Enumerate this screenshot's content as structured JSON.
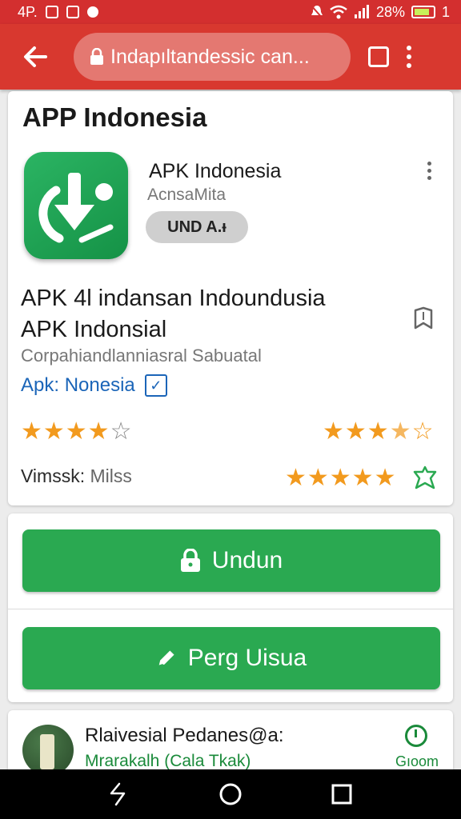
{
  "status_bar": {
    "time": "4P.",
    "battery_percent": "28%",
    "sim": "1",
    "battery_level": 0.7
  },
  "toolbar": {
    "url": "Indapıltandessic can..."
  },
  "page": {
    "title": "APP Indonesia"
  },
  "app": {
    "name": "APK Indonesia",
    "developer": "AcnsaMita",
    "chip_label": "UND A.ᵻ",
    "headline_line1": "APK 4l indansan Indoundusia",
    "headline_line2": "APK Indonsial",
    "subline": "Corpahiandlanniasral Sabuatal",
    "link_text": "Apk: Nonesia",
    "meta_label": "Vimssk:",
    "meta_value": "Milss"
  },
  "ratings": {
    "left_stars": 4,
    "right_stars_1": 3.5,
    "right_stars_2": 5
  },
  "actions": {
    "primary_label": "Undun",
    "secondary_label": "Perg Uisua"
  },
  "review": {
    "name": "Rlaivesial Pedanes@a:",
    "subtitle": "Mrarakalh (Cala Tkak)",
    "time": "Gıoom"
  },
  "colors": {
    "toolbar": "#d8382f",
    "accent_green": "#2aa951",
    "star": "#f29a1e",
    "link": "#1b65b8"
  }
}
